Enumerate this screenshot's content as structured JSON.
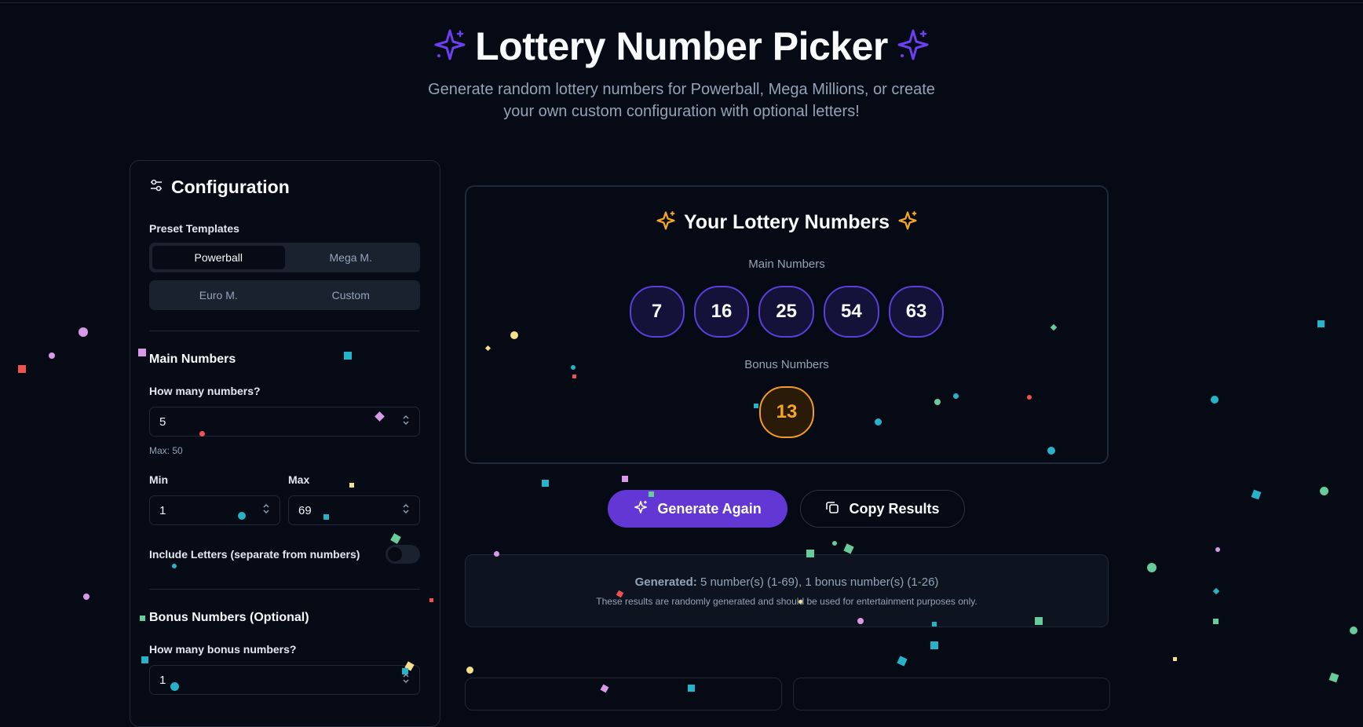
{
  "header": {
    "title": "Lottery Number Picker",
    "subtitle": "Generate random lottery numbers for Powerball, Mega Millions, or create your own custom configuration with optional letters!"
  },
  "config": {
    "title": "Configuration",
    "preset_label": "Preset Templates",
    "presets": [
      "Powerball",
      "Mega M.",
      "Euro M.",
      "Custom"
    ],
    "active_preset": "Powerball",
    "main_section": "Main Numbers",
    "how_many_label": "How many numbers?",
    "how_many_value": "5",
    "max_hint": "Max: 50",
    "min_label": "Min",
    "min_value": "1",
    "max_label": "Max",
    "max_value": "69",
    "letters_label": "Include Letters (separate from numbers)",
    "letters_enabled": false,
    "bonus_section": "Bonus Numbers (Optional)",
    "bonus_how_many_label": "How many bonus numbers?",
    "bonus_how_many_value": "1"
  },
  "results": {
    "title": "Your Lottery Numbers",
    "main_label": "Main Numbers",
    "main_numbers": [
      "7",
      "16",
      "25",
      "54",
      "63"
    ],
    "bonus_label": "Bonus Numbers",
    "bonus_numbers": [
      "13"
    ]
  },
  "actions": {
    "generate_label": "Generate Again",
    "copy_label": "Copy Results"
  },
  "info": {
    "generated_label": "Generated:",
    "generated_text": "5 number(s) (1-69), 1 bonus number(s) (1-26)",
    "disclaimer": "These results are randomly generated and should be used for entertainment purposes only."
  },
  "icons": {
    "sparkle_title": "sparkles-icon",
    "sparkle_results": "sparkles-icon",
    "config": "sliders-icon",
    "generate": "sparkles-icon",
    "copy": "copy-icon"
  },
  "colors": {
    "background": "#050a14",
    "accent_purple": "#6237d4",
    "ball_border": "#5b3fd9",
    "bonus_orange": "#f6a623",
    "muted_text": "#94a3b8"
  }
}
